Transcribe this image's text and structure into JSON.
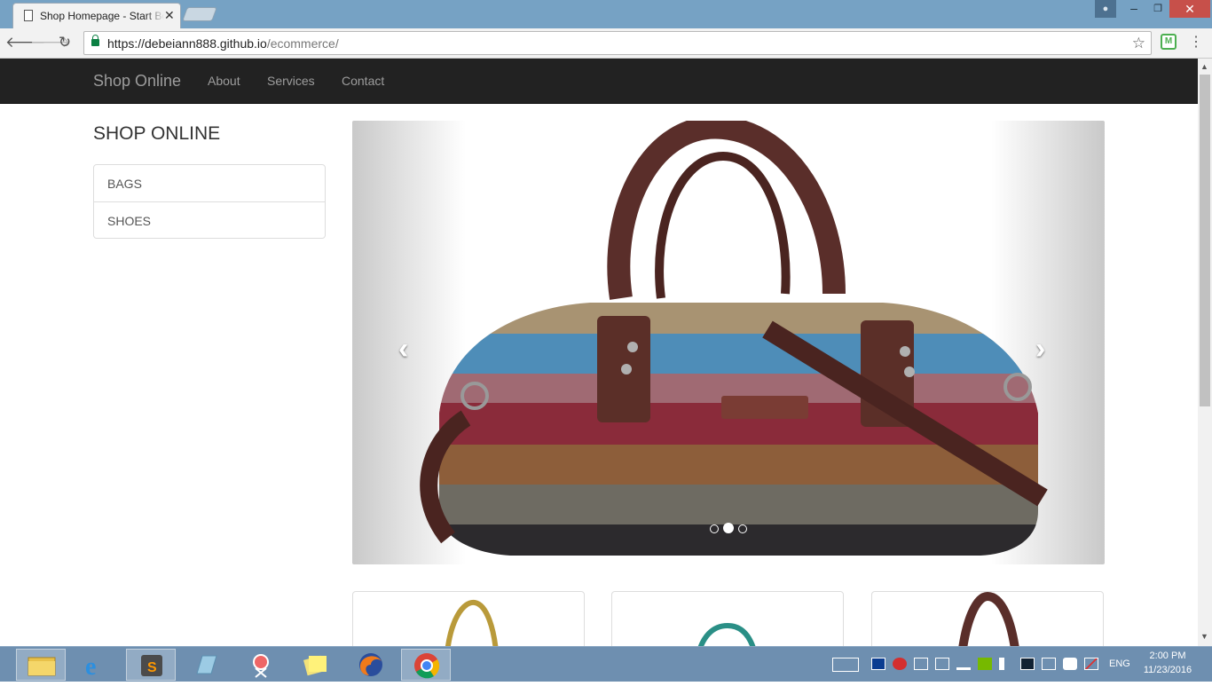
{
  "browser": {
    "tab_title": "Shop Homepage - Start Bootstrap",
    "tab_close": "✕",
    "url_host": "https://debeiann888.github.io",
    "url_path": "/ecommerce/",
    "back_icon": "🡐",
    "forward_icon": "🡒",
    "reload_icon": "↻",
    "star_icon": "☆",
    "menu_icon": "⋮",
    "ext_label": "M"
  },
  "navbar": {
    "brand": "Shop Online",
    "links": [
      "About",
      "Services",
      "Contact"
    ]
  },
  "sidebar": {
    "title": "SHOP ONLINE",
    "items": [
      "BAGS",
      "SHOES"
    ]
  },
  "carousel": {
    "prev": "‹",
    "next": "›",
    "slide_count": 3,
    "active_index": 1
  },
  "taskbar": {
    "lang": "ENG",
    "time": "2:00 PM",
    "date": "11/23/2016"
  },
  "colors": {
    "navbar_bg": "#222222",
    "nav_text": "#9d9d9d",
    "taskbar": "#6e8fb0",
    "titlebar": "#76a2c4",
    "close": "#c7504a"
  }
}
